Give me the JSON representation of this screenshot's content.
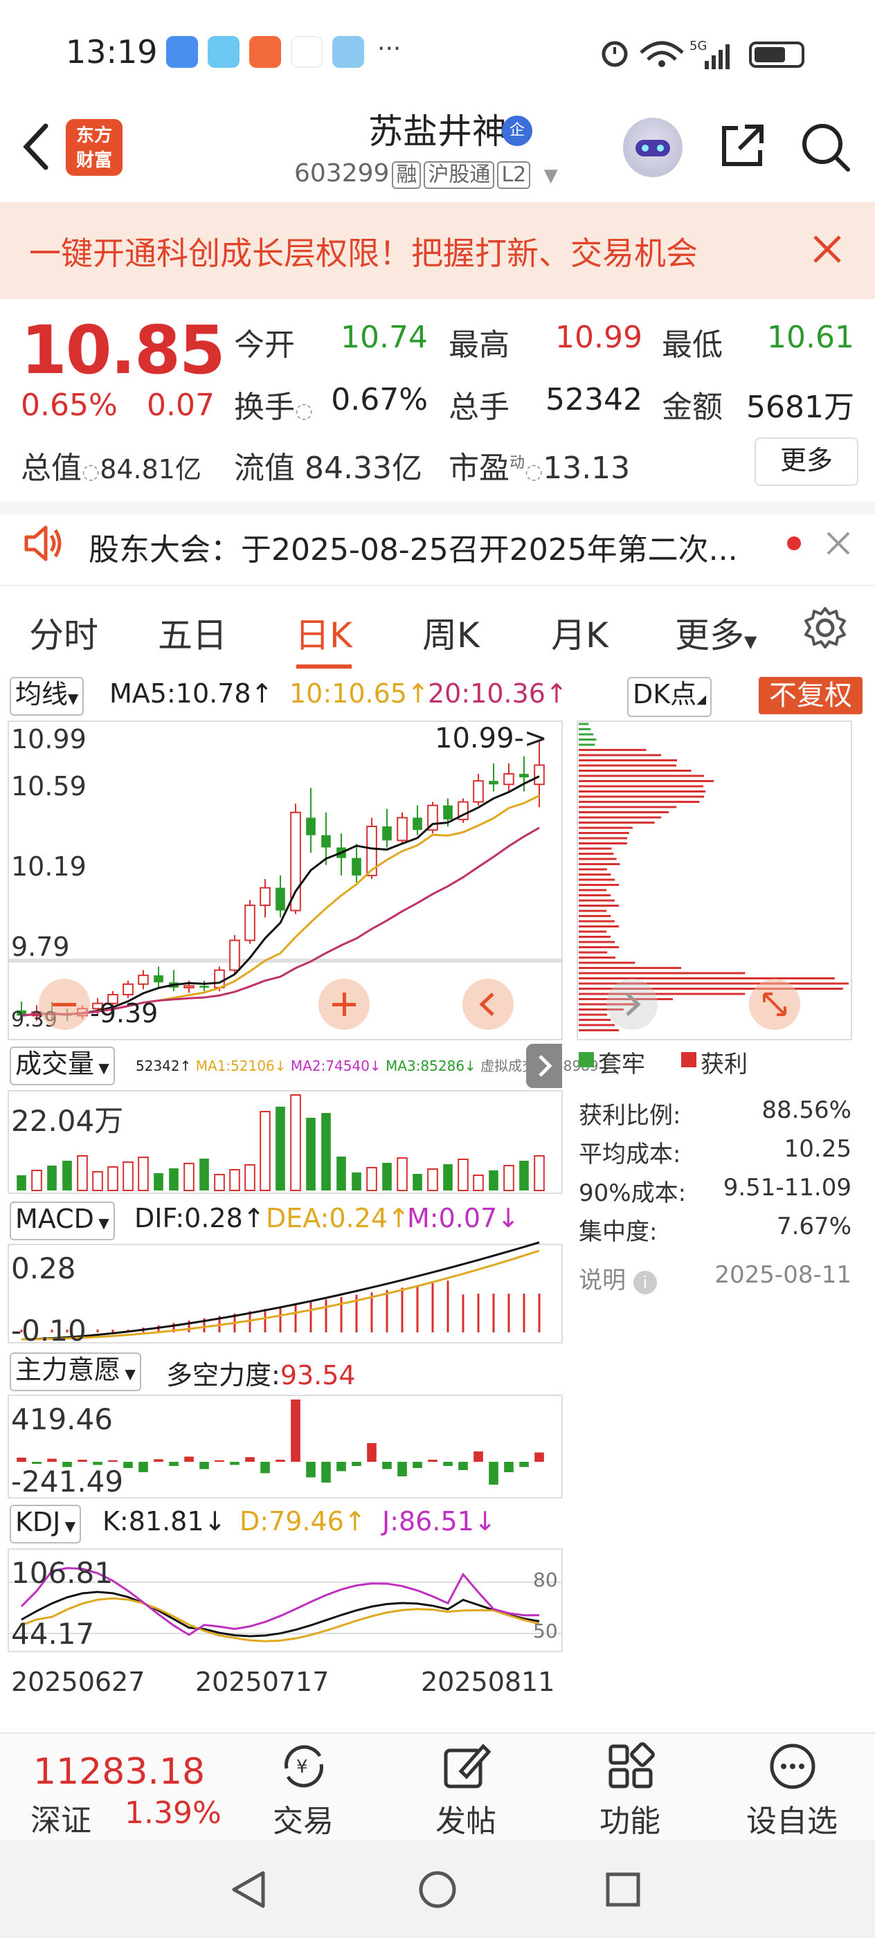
{
  "status_bar": {
    "time": "13:19",
    "dots": "···"
  },
  "header": {
    "logo_line1": "东方",
    "logo_line2": "财富",
    "stock_name": "苏盐井神",
    "badge": "企",
    "stock_code": "603299",
    "tags": [
      "融",
      "沪股通",
      "L2"
    ]
  },
  "banner": {
    "text": "一键开通科创成长层权限！把握打新、交易机会"
  },
  "quote": {
    "price": "10.85",
    "change_pct": "0.65%",
    "change": "0.07",
    "open_label": "今开",
    "open": "10.74",
    "high_label": "最高",
    "high": "10.99",
    "low_label": "最低",
    "low": "10.61",
    "turnover_label": "换手",
    "turnover": "0.67%",
    "volume_label": "总手",
    "volume": "52342",
    "amount_label": "金额",
    "amount": "5681万",
    "mktcap_label": "总值",
    "mktcap": "84.81亿",
    "float_label": "流值",
    "float": "84.33亿",
    "pe_label": "市盈",
    "pe_sup": "动",
    "pe": "13.13",
    "more": "更多"
  },
  "notice": {
    "text": "股东大会：于2025-08-25召开2025年第二次..."
  },
  "tabs": [
    "分时",
    "五日",
    "日K",
    "周K",
    "月K",
    "更多"
  ],
  "active_tab": "日K",
  "chart_header": {
    "ma_select": "均线",
    "ma5": "MA5:10.78↑",
    "ma10": "10:10.65↑",
    "ma20": "20:10.36↑",
    "dk_select": "DK点",
    "no_adjust": "不复权"
  },
  "chart_data": [
    {
      "type": "candlestick",
      "title": "日K",
      "y_ticks": [
        "10.99",
        "10.59",
        "10.19",
        "9.79",
        "9.39"
      ],
      "high_marker": "10.99->",
      "low_marker": "9.39",
      "candles": [
        {
          "o": 9.45,
          "h": 9.5,
          "l": 9.38,
          "c": 9.42
        },
        {
          "o": 9.42,
          "h": 9.48,
          "l": 9.39,
          "c": 9.44
        },
        {
          "o": 9.44,
          "h": 9.5,
          "l": 9.4,
          "c": 9.43
        },
        {
          "o": 9.43,
          "h": 9.46,
          "l": 9.39,
          "c": 9.42
        },
        {
          "o": 9.42,
          "h": 9.48,
          "l": 9.4,
          "c": 9.46
        },
        {
          "o": 9.46,
          "h": 9.52,
          "l": 9.43,
          "c": 9.49
        },
        {
          "o": 9.49,
          "h": 9.56,
          "l": 9.47,
          "c": 9.54
        },
        {
          "o": 9.54,
          "h": 9.62,
          "l": 9.52,
          "c": 9.6
        },
        {
          "o": 9.6,
          "h": 9.68,
          "l": 9.57,
          "c": 9.65
        },
        {
          "o": 9.65,
          "h": 9.7,
          "l": 9.58,
          "c": 9.61
        },
        {
          "o": 9.61,
          "h": 9.68,
          "l": 9.56,
          "c": 9.58
        },
        {
          "o": 9.58,
          "h": 9.62,
          "l": 9.55,
          "c": 9.59
        },
        {
          "o": 9.59,
          "h": 9.62,
          "l": 9.56,
          "c": 9.58
        },
        {
          "o": 9.58,
          "h": 9.7,
          "l": 9.56,
          "c": 9.68
        },
        {
          "o": 9.68,
          "h": 9.88,
          "l": 9.66,
          "c": 9.85
        },
        {
          "o": 9.85,
          "h": 10.08,
          "l": 9.83,
          "c": 10.05
        },
        {
          "o": 10.05,
          "h": 10.2,
          "l": 9.98,
          "c": 10.15
        },
        {
          "o": 10.15,
          "h": 10.22,
          "l": 9.98,
          "c": 10.02
        },
        {
          "o": 10.02,
          "h": 10.63,
          "l": 10.0,
          "c": 10.58
        },
        {
          "o": 10.55,
          "h": 10.72,
          "l": 10.35,
          "c": 10.45
        },
        {
          "o": 10.45,
          "h": 10.58,
          "l": 10.28,
          "c": 10.38
        },
        {
          "o": 10.38,
          "h": 10.46,
          "l": 10.22,
          "c": 10.32
        },
        {
          "o": 10.32,
          "h": 10.4,
          "l": 10.18,
          "c": 10.22
        },
        {
          "o": 10.22,
          "h": 10.55,
          "l": 10.2,
          "c": 10.5
        },
        {
          "o": 10.5,
          "h": 10.6,
          "l": 10.38,
          "c": 10.42
        },
        {
          "o": 10.42,
          "h": 10.58,
          "l": 10.4,
          "c": 10.55
        },
        {
          "o": 10.55,
          "h": 10.62,
          "l": 10.45,
          "c": 10.48
        },
        {
          "o": 10.48,
          "h": 10.64,
          "l": 10.46,
          "c": 10.62
        },
        {
          "o": 10.62,
          "h": 10.66,
          "l": 10.5,
          "c": 10.54
        },
        {
          "o": 10.54,
          "h": 10.66,
          "l": 10.52,
          "c": 10.64
        },
        {
          "o": 10.64,
          "h": 10.8,
          "l": 10.62,
          "c": 10.76
        },
        {
          "o": 10.76,
          "h": 10.86,
          "l": 10.7,
          "c": 10.74
        },
        {
          "o": 10.74,
          "h": 10.86,
          "l": 10.7,
          "c": 10.8
        },
        {
          "o": 10.8,
          "h": 10.9,
          "l": 10.7,
          "c": 10.78
        },
        {
          "o": 10.74,
          "h": 10.99,
          "l": 10.61,
          "c": 10.85
        }
      ]
    },
    {
      "type": "bar",
      "title": "成交量",
      "y_tick": "22.04万",
      "legend": [
        "52342↑",
        "MA1:52106↓",
        "MA2:74540↓",
        "MA3:85286↓",
        "虚拟成交量:68989"
      ]
    },
    {
      "type": "line",
      "title": "MACD",
      "dif": "DIF:0.28↑",
      "dea": "DEA:0.24↑",
      "m": "M:0.07↓",
      "y_ticks": [
        "0.28",
        "-0.10"
      ]
    },
    {
      "type": "bar",
      "title": "主力意愿",
      "force_label": "多空力度:",
      "force_value": "93.54",
      "y_ticks": [
        "419.46",
        "-241.49"
      ]
    },
    {
      "type": "line",
      "title": "KDJ",
      "k": "K:81.81↓",
      "d": "D:79.46↑",
      "j": "J:86.51↓",
      "y_ticks": [
        "106.81",
        "44.17"
      ],
      "ref_lines": [
        "80",
        "50"
      ],
      "x_ticks": [
        "20250627",
        "20250717",
        "20250811"
      ]
    }
  ],
  "chips": {
    "legend_trapped": "套牢",
    "legend_profit": "获利",
    "rows": [
      {
        "label": "获利比例:",
        "value": "88.56%"
      },
      {
        "label": "平均成本:",
        "value": "10.25"
      },
      {
        "label": "90%成本:",
        "value": "9.51-11.09"
      },
      {
        "label": "集中度:",
        "value": "7.67%"
      }
    ],
    "note_label": "说明",
    "date": "2025-08-11"
  },
  "index": {
    "value": "11283.18",
    "name": "深证",
    "pct": "1.39%"
  },
  "bottom_nav": [
    "交易",
    "发帖",
    "功能",
    "设自选"
  ],
  "colors": {
    "up": "#d8302f",
    "down": "#2a9a2a",
    "accent": "#e5502b",
    "ma10": "#e0a820",
    "ma20": "#c0306a"
  }
}
